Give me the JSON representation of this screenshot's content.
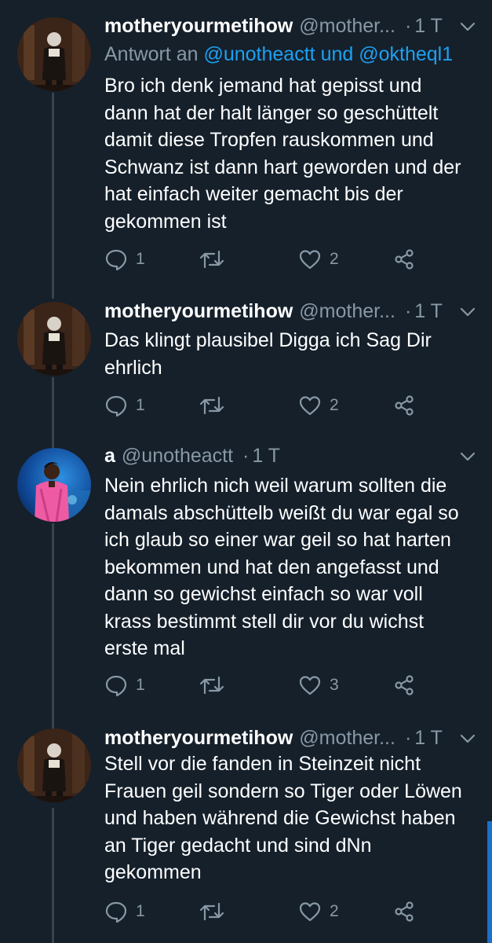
{
  "tweets": [
    {
      "name": "motheryourmetihow",
      "handle": "@mother...",
      "dot": "·",
      "time": "1 T",
      "reply_prefix": "Antwort an",
      "reply_user1": "@unotheactt",
      "reply_and": "und",
      "reply_user2": "@oktheql1",
      "text": "Bro ich denk jemand hat gepisst und\ndann hat der halt länger so geschüttelt\ndamit diese Tropfen rauskommen und\nSchwanz ist dann hart geworden und der\nhat einfach weiter gemacht bis der\ngekommen ist",
      "replies": "1",
      "likes": "2",
      "avatar": "dark-stage-photo"
    },
    {
      "name": "motheryourmetihow",
      "handle": "@mother...",
      "dot": "·",
      "time": "1 T",
      "text": "Das klingt plausibel Digga ich Sag Dir\nehrlich",
      "replies": "1",
      "likes": "2",
      "avatar": "dark-stage-photo"
    },
    {
      "name": "a",
      "handle": "@unotheactt",
      "dot": "·",
      "time": "1 T",
      "text": "Nein ehrlich nich weil warum sollten die\ndamals abschüttelb weißt du war egal so\nich glaub so einer war geil so hat harten\nbekommen und hat den angefasst und\ndann so gewichst einfach so war voll\nkrass bestimmt stell dir vor du wichst\nerste mal",
      "replies": "1",
      "likes": "3",
      "avatar": "pink-jacket-blue-light-photo"
    },
    {
      "name": "motheryourmetihow",
      "handle": "@mother...",
      "dot": "·",
      "time": "1 T",
      "text": "Stell vor die fanden in Steinzeit nicht\nFrauen geil sondern so Tiger oder Löwen\nund haben während die Gewichst haben\nan Tiger gedacht und sind dNn\ngekommen",
      "replies": "1",
      "likes": "2",
      "avatar": "dark-stage-photo"
    }
  ],
  "icons": {
    "reply": "speech-bubble-icon",
    "retweet": "retweet-arrows-icon",
    "like": "heart-icon",
    "share": "share-nodes-icon",
    "menu": "chevron-down-icon"
  },
  "colors": {
    "background": "#15202b",
    "secondary_text": "#8899a6",
    "mention": "#1da1f2",
    "thread_line": "#38444d"
  }
}
